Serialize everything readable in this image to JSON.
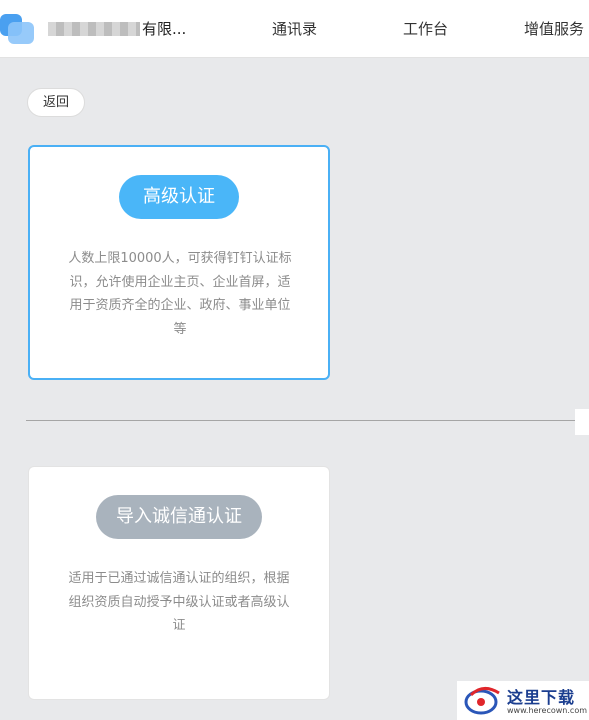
{
  "header": {
    "org_name": "有限...",
    "nav": [
      "通讯录",
      "工作台",
      "增值服务"
    ]
  },
  "back_label": "返回",
  "cards": [
    {
      "title": "高级认证",
      "desc": "人数上限10000人，可获得钉钉认证标识，允许使用企业主页、企业首屏，适用于资质齐全的企业、政府、事业单位等"
    },
    {
      "title": "导入诚信通认证",
      "desc": "适用于已通过诚信通认证的组织，根据组织资质自动授予中级认证或者高级认证"
    }
  ],
  "watermark": {
    "text": "这里下载",
    "url": "www.herecown.com"
  },
  "colors": {
    "accent": "#4ab6f8",
    "card_selected_border": "#4ab0f5",
    "disabled_pill": "#a9b3bd",
    "page_bg": "#e8e9eb"
  }
}
